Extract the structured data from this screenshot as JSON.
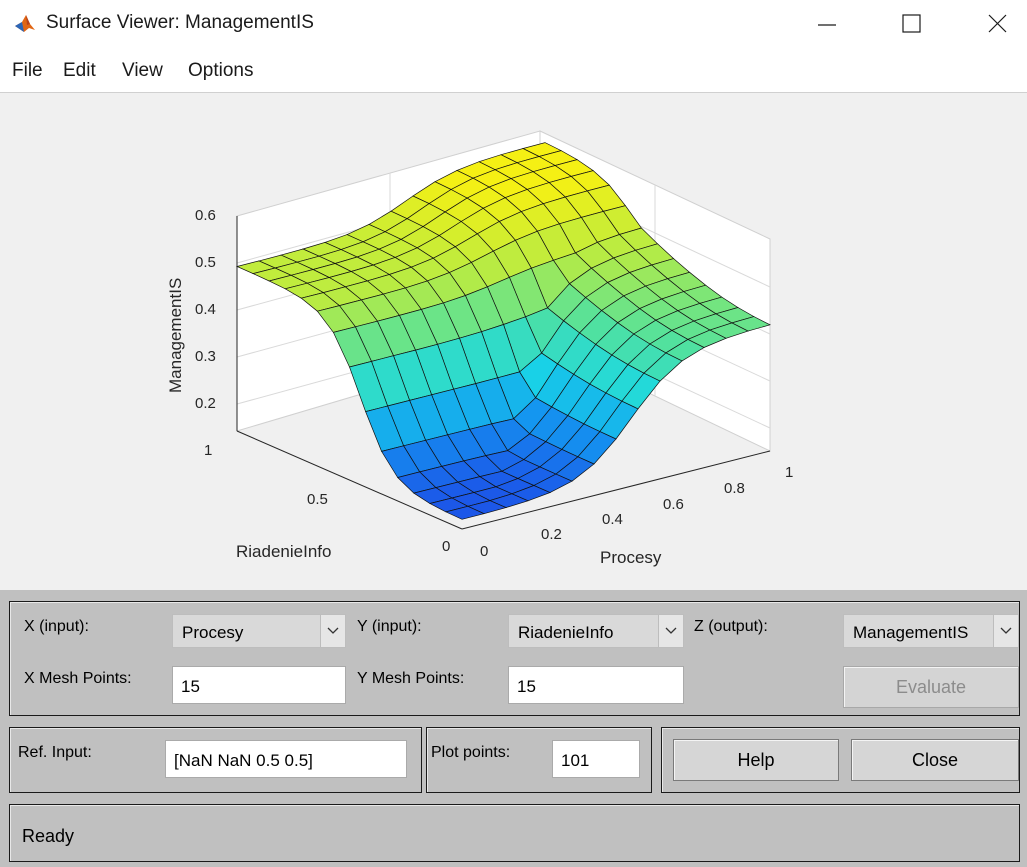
{
  "window": {
    "title": "Surface Viewer: ManagementIS",
    "icon": "matlab-logo-icon",
    "controls": [
      "minimize-icon",
      "maximize-icon",
      "close-icon"
    ]
  },
  "menu": {
    "items": [
      "File",
      "Edit",
      "View",
      "Options"
    ]
  },
  "plot": {
    "z_label": "ManagementIS",
    "x_label": "Procesy",
    "y_label": "RiadenieInfo",
    "z_ticks": [
      "0.2",
      "0.3",
      "0.4",
      "0.5",
      "0.6"
    ],
    "x_ticks": [
      "0",
      "0.2",
      "0.4",
      "0.6",
      "0.8",
      "1"
    ],
    "y_ticks": [
      "0",
      "0.5",
      "1"
    ],
    "colormap": "parula",
    "colors": {
      "low": "#1e63e8",
      "mid": "#19d9e6",
      "high": "#f5f50f"
    }
  },
  "chart_data": {
    "type": "surface",
    "title": "",
    "xlabel": "Procesy",
    "ylabel": "RiadenieInfo",
    "zlabel": "ManagementIS",
    "xlim": [
      0,
      1
    ],
    "ylim": [
      0,
      1
    ],
    "zlim": [
      0.15,
      0.6
    ],
    "mesh_points": [
      15,
      15
    ],
    "shape_description": "Low values (~0.15-0.2) for small Procesy and small RiadenieInfo; rises to ~0.5 plateau at high RiadenieInfo edge and ~0.6 peak at high Procesy / high RiadenieInfo corner"
  },
  "controls": {
    "x_input_label": "X (input):",
    "x_input_value": "Procesy",
    "y_input_label": "Y (input):",
    "y_input_value": "RiadenieInfo",
    "z_output_label": "Z (output):",
    "z_output_value": "ManagementIS",
    "x_mesh_label": "X Mesh Points:",
    "x_mesh_value": "15",
    "y_mesh_label": "Y Mesh Points:",
    "y_mesh_value": "15",
    "evaluate_label": "Evaluate",
    "ref_input_label": "Ref. Input:",
    "ref_input_value": "[NaN NaN 0.5 0.5]",
    "plot_points_label": "Plot points:",
    "plot_points_value": "101",
    "help_label": "Help",
    "close_label": "Close"
  },
  "status": {
    "text": "Ready"
  }
}
